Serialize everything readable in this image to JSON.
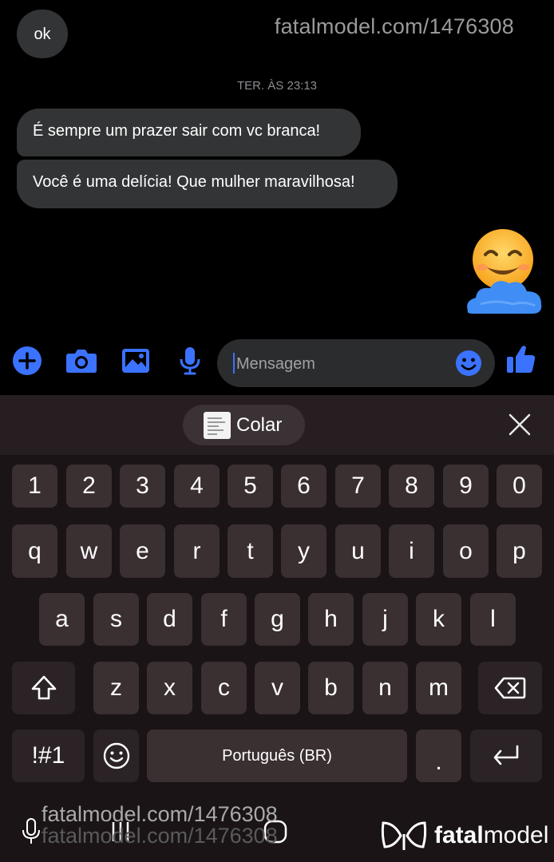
{
  "watermark": "fatalmodel.com/1476308",
  "conversation": {
    "ok_message": "ok",
    "timestamp": "TER. ÀS 23:13",
    "messages": [
      "É sempre um prazer sair com vc branca!",
      "Você é uma delícia! Que mulher maravilhosa!"
    ],
    "reaction_emoji": "😊"
  },
  "composer": {
    "placeholder": "Mensagem",
    "icons": [
      "plus-icon",
      "camera-icon",
      "gallery-icon",
      "microphone-icon",
      "emoji-icon",
      "thumbs-up-icon"
    ]
  },
  "keyboard": {
    "paste_label": "Colar",
    "number_row": [
      "1",
      "2",
      "3",
      "4",
      "5",
      "6",
      "7",
      "8",
      "9",
      "0"
    ],
    "row1": [
      "q",
      "w",
      "e",
      "r",
      "t",
      "y",
      "u",
      "i",
      "o",
      "p"
    ],
    "row2": [
      "a",
      "s",
      "d",
      "f",
      "g",
      "h",
      "j",
      "k",
      "l"
    ],
    "row3": [
      "z",
      "x",
      "c",
      "v",
      "b",
      "n",
      "m"
    ],
    "symbols_key": "!#1",
    "space_label": "Português (BR)",
    "period_key": "."
  },
  "brand": {
    "name_bold": "fatal",
    "name_regular": "model"
  },
  "colors": {
    "accent_blue": "#3b72ff",
    "bubble_gray": "#333436",
    "keyboard_bg": "#1a1416",
    "key_bg": "#3a2f31"
  }
}
